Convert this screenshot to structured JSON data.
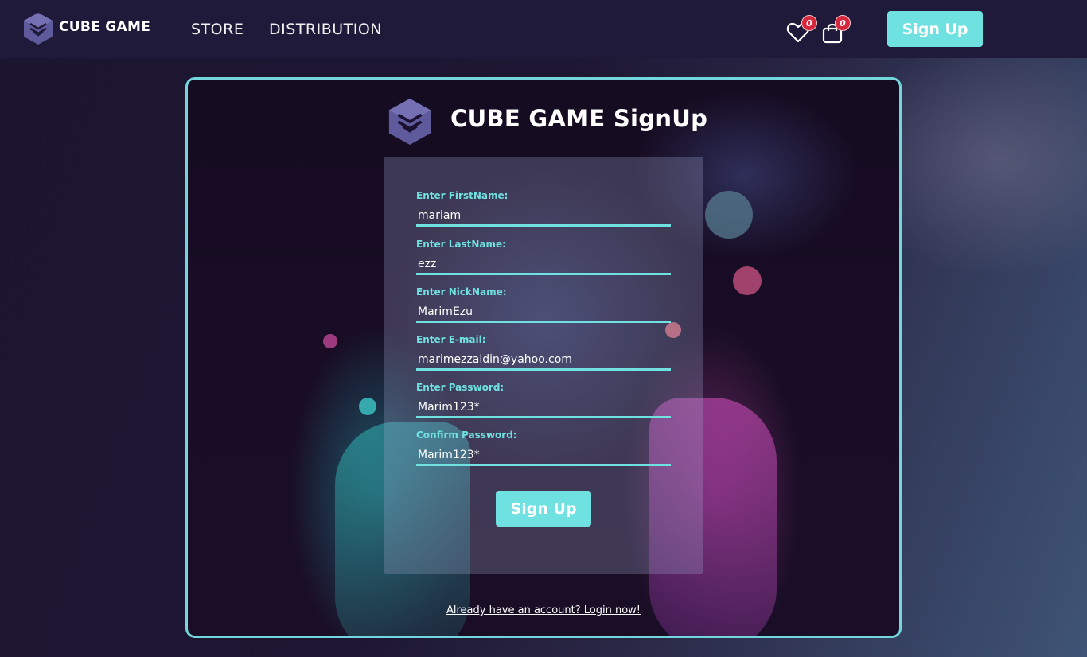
{
  "header": {
    "brand": "CUBE GAME",
    "nav": [
      {
        "label": "STORE"
      },
      {
        "label": "DISTRIBUTION"
      }
    ],
    "favorites_count": "0",
    "cart_count": "0",
    "signup_label": "Sign Up",
    "logo_icon": "cube-logo-icon",
    "favorites_icon": "heart-icon",
    "cart_icon": "shopping-bag-icon"
  },
  "card": {
    "title": "CUBE GAME SignUp",
    "fields": [
      {
        "label": "Enter FirstName:",
        "value": "mariam"
      },
      {
        "label": "Enter LastName:",
        "value": "ezz"
      },
      {
        "label": "Enter NickName:",
        "value": "MarimEzu"
      },
      {
        "label": "Enter E-mail:",
        "value": "marimezzaldin@yahoo.com"
      },
      {
        "label": "Enter Password:",
        "value": "Marim123*"
      },
      {
        "label": "Confirm Password:",
        "value": "Marim123*"
      }
    ],
    "submit_label": "Sign Up",
    "login_link": "Already have an account? Login now!"
  },
  "colors": {
    "accent": "#6fe1e0",
    "header_bg": "#1f1a3a",
    "badge": "#d6283c",
    "logo": "#5f5a9c"
  }
}
